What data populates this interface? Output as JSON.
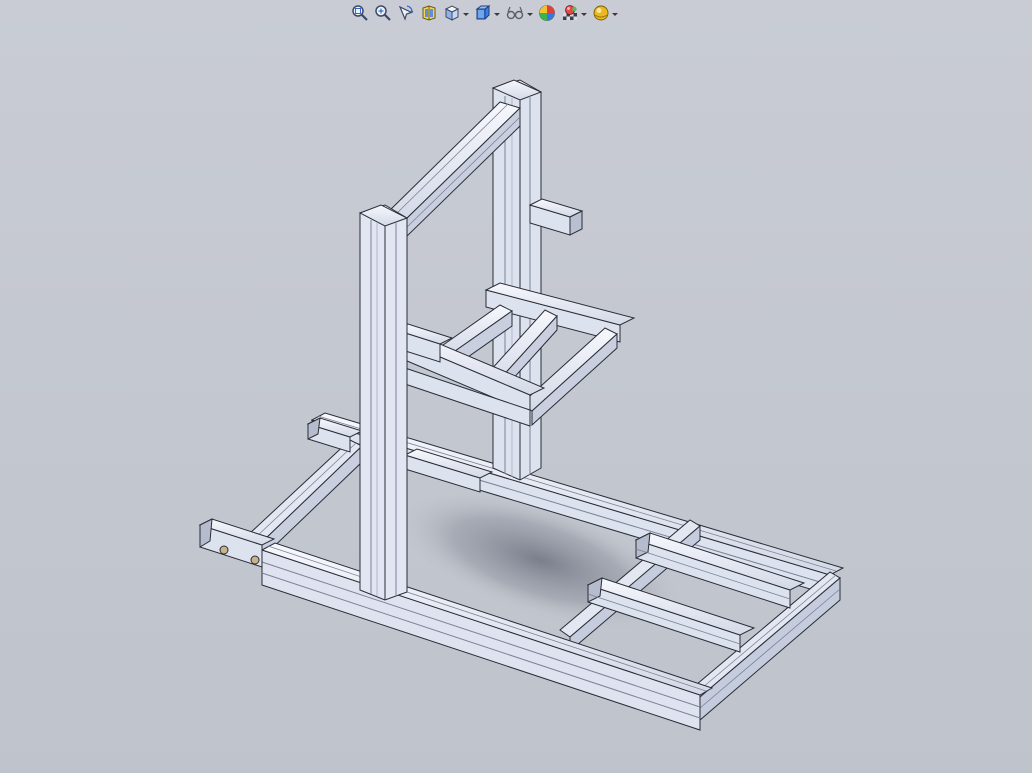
{
  "viewport": {
    "background_top": "#c9ccd4",
    "background_bottom": "#bfc3cb"
  },
  "toolbar": {
    "buttons": [
      {
        "icon": "zoom-to-fit-icon",
        "dropdown": false
      },
      {
        "icon": "zoom-to-area-icon",
        "dropdown": false
      },
      {
        "icon": "previous-view-icon",
        "dropdown": false
      },
      {
        "icon": "section-view-icon",
        "dropdown": false
      },
      {
        "icon": "view-orientation-icon",
        "dropdown": true
      },
      {
        "icon": "display-style-icon",
        "dropdown": true
      },
      {
        "icon": "hide-show-items-icon",
        "dropdown": true
      },
      {
        "icon": "edit-appearance-icon",
        "dropdown": false
      },
      {
        "icon": "apply-scene-icon",
        "dropdown": true
      },
      {
        "icon": "view-settings-icon",
        "dropdown": true
      }
    ]
  },
  "model": {
    "name": "",
    "profile_color": "#dde2ef",
    "profile_shadow": "#8d93a6",
    "edge_color": "#2a2d36"
  }
}
